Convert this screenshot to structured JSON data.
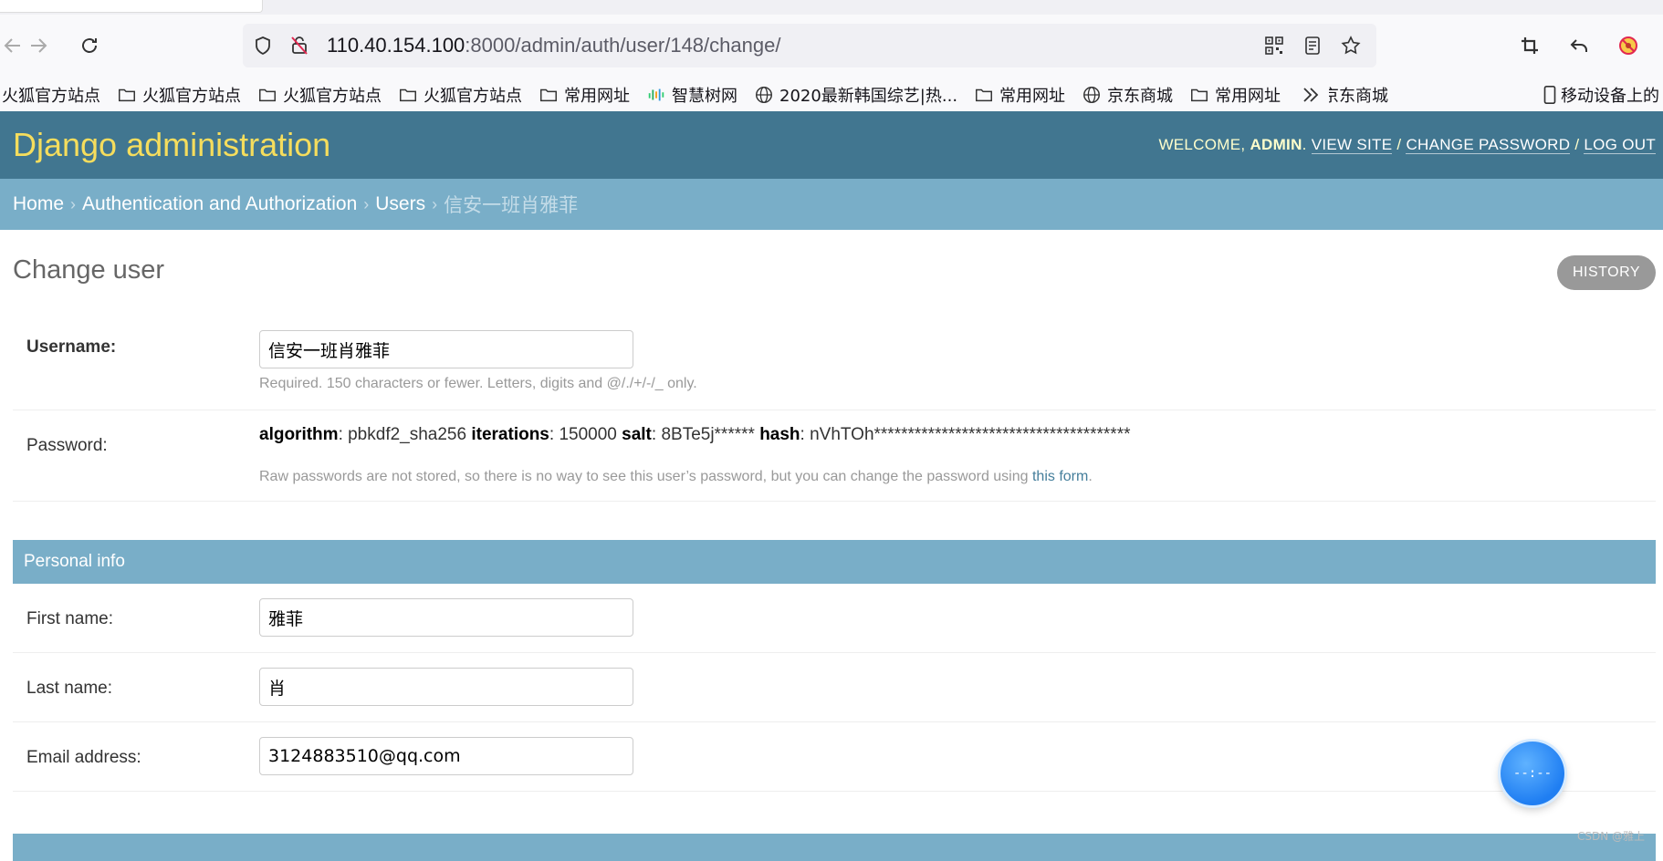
{
  "browser": {
    "url_host": "110.40.154.100",
    "url_rest": ":8000/admin/auth/user/148/change/",
    "bookmarks": [
      {
        "label": "火狐官方站点",
        "icon": "none"
      },
      {
        "label": "火狐官方站点",
        "icon": "folder-icon"
      },
      {
        "label": "火狐官方站点",
        "icon": "folder-icon"
      },
      {
        "label": "火狐官方站点",
        "icon": "folder-icon"
      },
      {
        "label": "常用网址",
        "icon": "folder-icon"
      },
      {
        "label": "智慧树网",
        "icon": "zhihuishu-icon"
      },
      {
        "label": "2020最新韩国综艺|热...",
        "icon": "globe-icon"
      },
      {
        "label": "常用网址",
        "icon": "folder-icon"
      },
      {
        "label": "京东商城",
        "icon": "globe-icon"
      },
      {
        "label": "常用网址",
        "icon": "folder-icon"
      },
      {
        "label": "京东商城",
        "icon": "globe-icon"
      }
    ],
    "mobile_bookmarks": "移动设备上的"
  },
  "header": {
    "branding": "Django administration",
    "welcome": "WELCOME, ",
    "user": "ADMIN",
    "dot": ". ",
    "view_site": "VIEW SITE",
    "change_password": "CHANGE PASSWORD",
    "log_out": "LOG OUT",
    "slash": " / "
  },
  "breadcrumbs": {
    "home": "Home",
    "app": "Authentication and Authorization",
    "model": "Users",
    "current": "信安一班肖雅菲",
    "sep": "›"
  },
  "page": {
    "title": "Change user",
    "history": "HISTORY"
  },
  "form": {
    "username_label": "Username:",
    "username_value": "信安一班肖雅菲",
    "username_help": "Required. 150 characters or fewer. Letters, digits and @/./+/-/_ only.",
    "password_label": "Password:",
    "pwd_algorithm_key": "algorithm",
    "pwd_algorithm_val": ": pbkdf2_sha256 ",
    "pwd_iterations_key": "iterations",
    "pwd_iterations_val": ": 150000 ",
    "pwd_salt_key": "salt",
    "pwd_salt_val": ": 8BTe5j****** ",
    "pwd_hash_key": "hash",
    "pwd_hash_val": ": nVhTOh**************************************",
    "pwd_help_prefix": "Raw passwords are not stored, so there is no way to see this user’s password, but you can change the password using ",
    "pwd_help_link": "this form",
    "pwd_help_suffix": ".",
    "personal_info": "Personal info",
    "first_name_label": "First name:",
    "first_name_value": "雅菲",
    "last_name_label": "Last name:",
    "last_name_value": "肖",
    "email_label": "Email address:",
    "email_value": "3124883510@qq.com"
  },
  "widget": {
    "text": "--:--"
  },
  "watermark": "CSDN @雅上"
}
